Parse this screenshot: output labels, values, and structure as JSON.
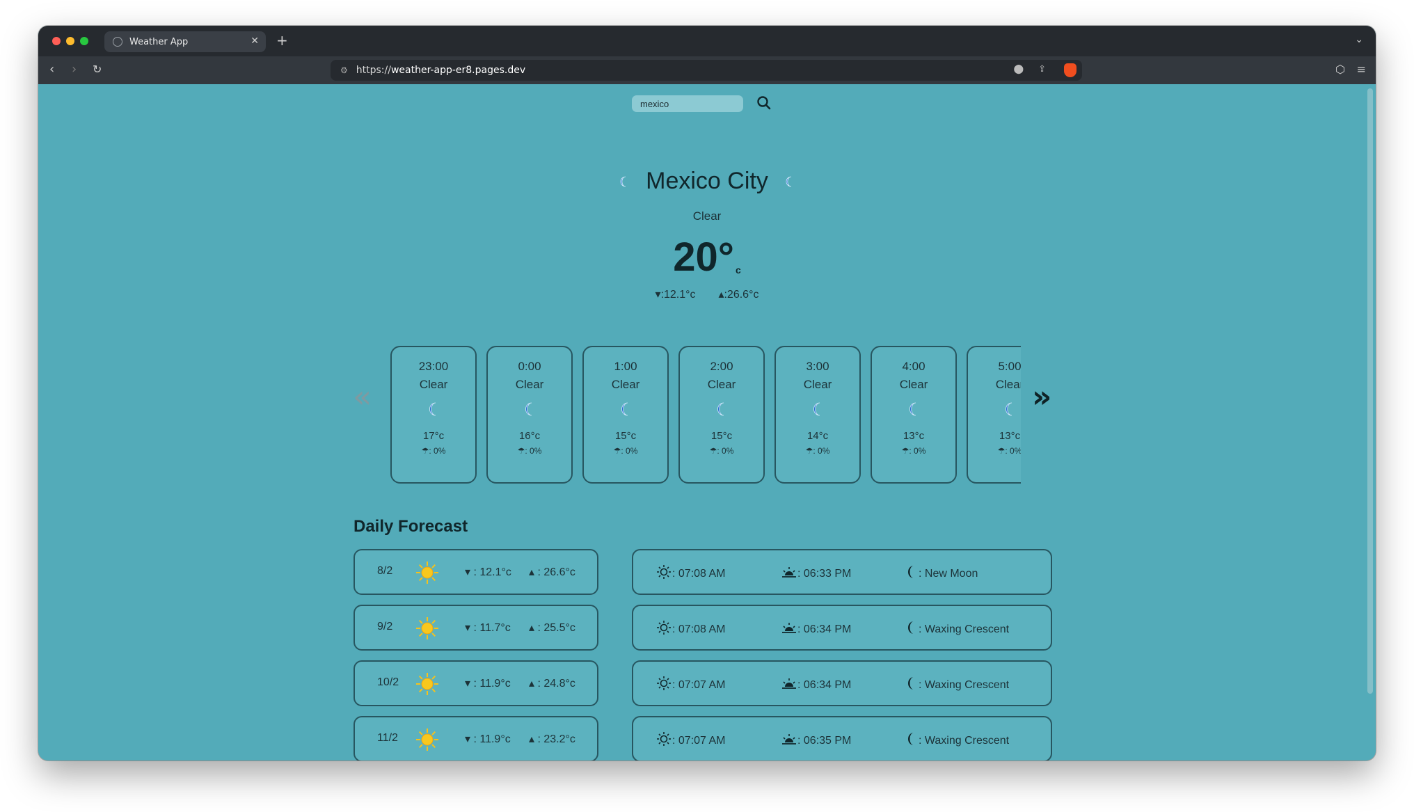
{
  "browser": {
    "tab_title": "Weather App",
    "tab_close": "✕",
    "new_tab": "+",
    "url_scheme": "https://",
    "url_host": "weather-app-er8.pages.dev"
  },
  "search": {
    "value": "mexico"
  },
  "current": {
    "city": "Mexico City",
    "condition": "Clear",
    "temp": "20°",
    "unit": "c",
    "min": ":12.1°c",
    "max": ":26.6°c"
  },
  "hourly": [
    {
      "time": "23:00",
      "cond": "Clear",
      "temp": "17°c",
      "rain": ": 0%"
    },
    {
      "time": "0:00",
      "cond": "Clear",
      "temp": "16°c",
      "rain": ": 0%"
    },
    {
      "time": "1:00",
      "cond": "Clear",
      "temp": "15°c",
      "rain": ": 0%"
    },
    {
      "time": "2:00",
      "cond": "Clear",
      "temp": "15°c",
      "rain": ": 0%"
    },
    {
      "time": "3:00",
      "cond": "Clear",
      "temp": "14°c",
      "rain": ": 0%"
    },
    {
      "time": "4:00",
      "cond": "Clear",
      "temp": "13°c",
      "rain": ": 0%"
    },
    {
      "time": "5:00",
      "cond": "Clear",
      "temp": "13°c",
      "rain": ": 0%"
    }
  ],
  "arrows": {
    "prev": "«",
    "next": "»"
  },
  "daily_title": "Daily Forecast",
  "daily": [
    {
      "date": "8/2",
      "min": ": 12.1°c",
      "max": ": 26.6°c",
      "sunrise": ": 07:08 AM",
      "sunset": ": 06:33 PM",
      "moon": ": New Moon"
    },
    {
      "date": "9/2",
      "min": ": 11.7°c",
      "max": ": 25.5°c",
      "sunrise": ": 07:08 AM",
      "sunset": ": 06:34 PM",
      "moon": ": Waxing Crescent"
    },
    {
      "date": "10/2",
      "min": ": 11.9°c",
      "max": ": 24.8°c",
      "sunrise": ": 07:07 AM",
      "sunset": ": 06:34 PM",
      "moon": ": Waxing Crescent"
    },
    {
      "date": "11/2",
      "min": ": 11.9°c",
      "max": ": 23.2°c",
      "sunrise": ": 07:07 AM",
      "sunset": ": 06:35 PM",
      "moon": ": Waxing Crescent"
    }
  ],
  "colors": {
    "page_bg": "#53abb9",
    "card_border": "#275660",
    "moon_blue": "#2a6fd0",
    "sun_yellow": "#f6c21a"
  }
}
